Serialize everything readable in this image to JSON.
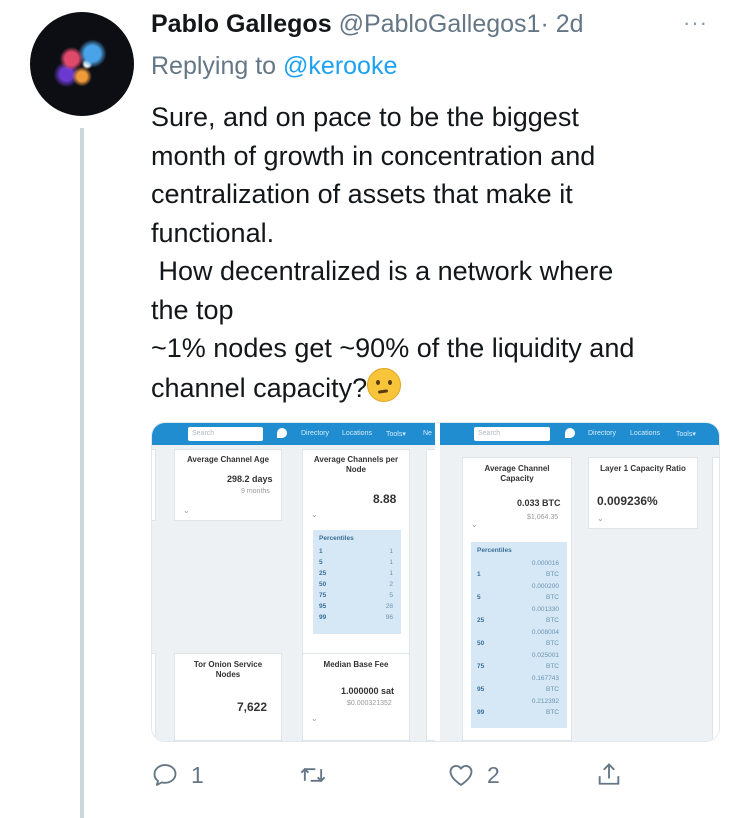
{
  "tweet": {
    "name": "Pablo Gallegos",
    "handle": "@PabloGallegos1",
    "dot": "·",
    "time": "2d",
    "more": "···",
    "replying_prefix": "Replying to ",
    "replying_to": "@kerooke",
    "lines": [
      "Sure, and on pace to be the biggest",
      "month of growth in concentration and",
      "centralization of assets that make it",
      "functional.",
      " How decentralized is a network where",
      "the top",
      "~1% nodes get ~90% of the liquidity and",
      "channel capacity?"
    ],
    "emoji": "thinking-face"
  },
  "media": {
    "left": {
      "search_placeholder": "Search",
      "nav": [
        "Directory",
        "Locations",
        "Tools▾",
        "Ne"
      ],
      "avg_channel_age": {
        "title": "Average Channel Age",
        "value": "298.2 days",
        "sub": "9 months"
      },
      "avg_channels_per_node": {
        "title_1": "Average Channels per",
        "title_2": "Node",
        "value": "8.88"
      },
      "percentiles": {
        "title": "Percentiles",
        "rows": [
          [
            "1",
            "1"
          ],
          [
            "5",
            "1"
          ],
          [
            "25",
            "1"
          ],
          [
            "50",
            "2"
          ],
          [
            "75",
            "5"
          ],
          [
            "95",
            "28"
          ],
          [
            "99",
            "96"
          ]
        ]
      },
      "tor_nodes": {
        "title_1": "Tor Onion Service",
        "title_2": "Nodes",
        "value": "7,622"
      },
      "median_base_fee": {
        "title": "Median Base Fee",
        "value": "1.000000 sat",
        "sub": "$0.000321352"
      }
    },
    "right": {
      "search_placeholder": "Search",
      "nav": [
        "Directory",
        "Locations",
        "Tools▾"
      ],
      "avg_channel_capacity": {
        "title_1": "Average Channel",
        "title_2": "Capacity",
        "value": "0.033 BTC",
        "sub": "$1,064.35"
      },
      "layer1_ratio": {
        "title": "Layer 1 Capacity Ratio",
        "value": "0.009236%"
      },
      "percentiles": {
        "title": "Percentiles",
        "rows": [
          [
            "",
            "0.000016"
          ],
          [
            "1",
            "BTC"
          ],
          [
            "",
            "0.000200"
          ],
          [
            "5",
            "BTC"
          ],
          [
            "",
            "0.001330"
          ],
          [
            "25",
            "BTC"
          ],
          [
            "",
            "0.008004"
          ],
          [
            "50",
            "BTC"
          ],
          [
            "",
            "0.025001"
          ],
          [
            "75",
            "BTC"
          ],
          [
            "",
            "0.167743"
          ],
          [
            "95",
            "BTC"
          ],
          [
            "",
            "0.212392"
          ],
          [
            "99",
            "BTC"
          ]
        ]
      }
    }
  },
  "actions": {
    "replies": "1",
    "retweets": "",
    "likes": "2"
  },
  "colors": {
    "accent": "#1da1f2",
    "muted": "#657786",
    "topbar": "#1f8dd0",
    "percentile_bg": "#d6e8f5"
  }
}
